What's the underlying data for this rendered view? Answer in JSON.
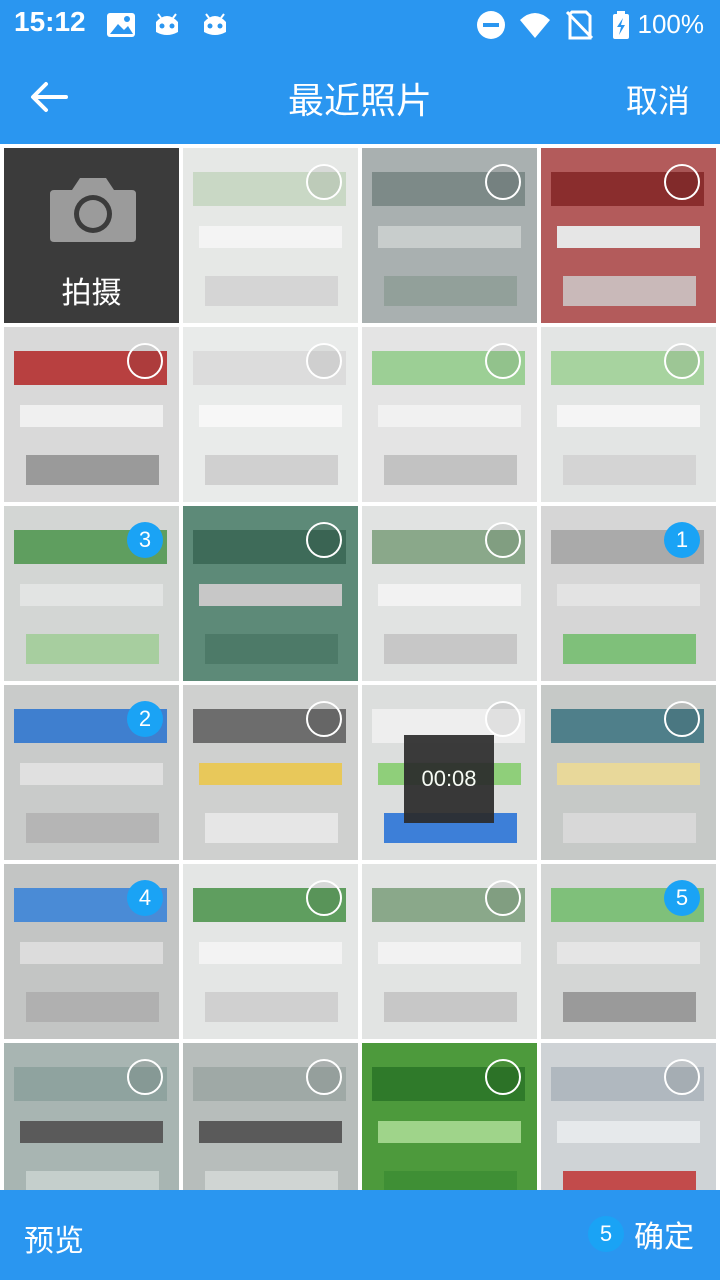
{
  "status_bar": {
    "time": "15:12",
    "battery": "100%",
    "icons": [
      "image-icon",
      "robot-icon",
      "robot-icon",
      "do-not-disturb-icon",
      "wifi-icon",
      "no-sim-icon",
      "battery-charging-icon"
    ]
  },
  "header": {
    "back_icon": "arrow-left-icon",
    "title": "最近照片",
    "cancel_label": "取消"
  },
  "camera_tile": {
    "icon": "camera-icon",
    "label": "拍摄"
  },
  "photos": [
    {
      "selected": false,
      "order": ""
    },
    {
      "selected": false,
      "order": ""
    },
    {
      "selected": false,
      "order": ""
    },
    {
      "selected": false,
      "order": ""
    },
    {
      "selected": false,
      "order": ""
    },
    {
      "selected": false,
      "order": ""
    },
    {
      "selected": false,
      "order": ""
    },
    {
      "selected": true,
      "order": "3"
    },
    {
      "selected": false,
      "order": ""
    },
    {
      "selected": false,
      "order": ""
    },
    {
      "selected": true,
      "order": "1"
    },
    {
      "selected": true,
      "order": "2"
    },
    {
      "selected": false,
      "order": ""
    },
    {
      "selected": false,
      "order": "",
      "overlay_time": "00:08"
    },
    {
      "selected": false,
      "order": ""
    },
    {
      "selected": true,
      "order": "4"
    },
    {
      "selected": false,
      "order": ""
    },
    {
      "selected": false,
      "order": ""
    },
    {
      "selected": true,
      "order": "5"
    },
    {
      "selected": false,
      "order": ""
    },
    {
      "selected": false,
      "order": ""
    },
    {
      "selected": false,
      "order": ""
    },
    {
      "selected": false,
      "order": ""
    }
  ],
  "footer": {
    "preview_label": "预览",
    "selected_count": "5",
    "confirm_label": "确定"
  },
  "colors": {
    "primary": "#2a96f0",
    "badge": "#1aa3f5"
  }
}
